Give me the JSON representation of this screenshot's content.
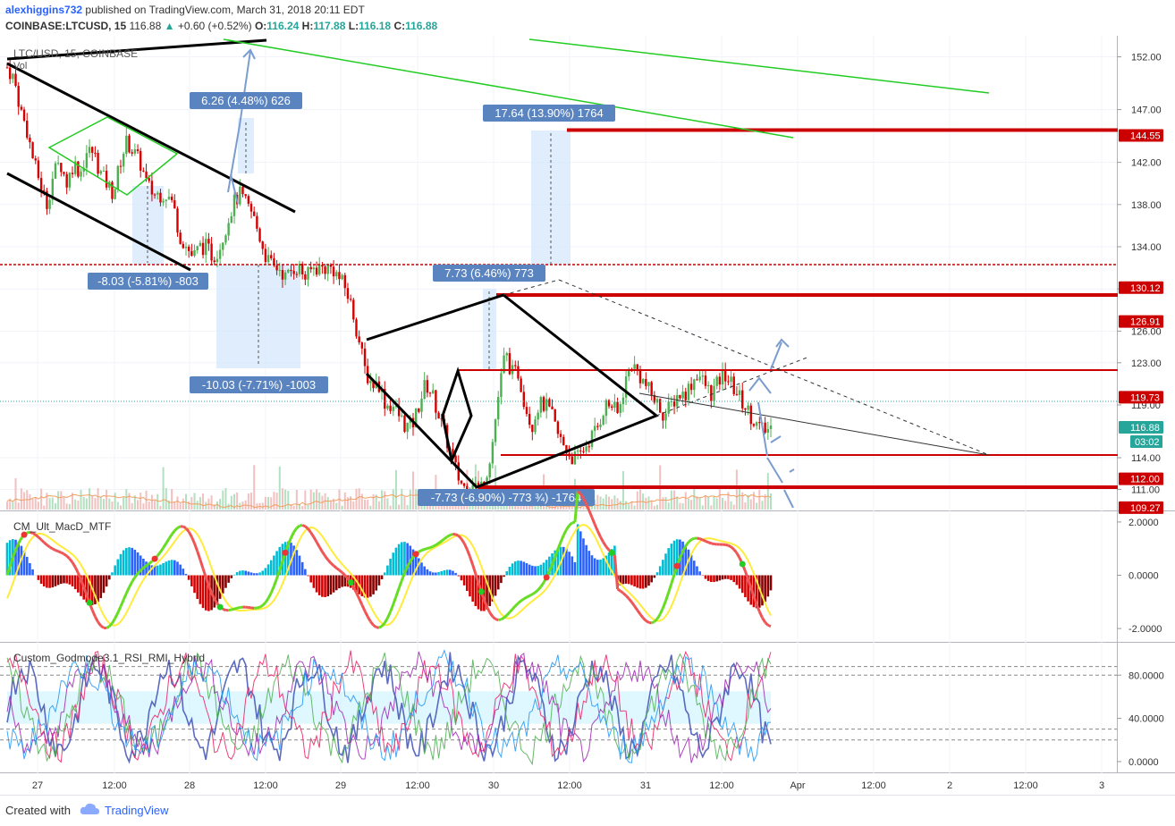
{
  "header": {
    "author": "alexhiggins732",
    "published": "published on TradingView.com, March 31, 2018 20:11 EDT",
    "symbol": "COINBASE:LTCUSD, 15",
    "last": "116.88",
    "change": "+0.60 (+0.52%)",
    "o_label": "O:",
    "o": "116.24",
    "h_label": "H:",
    "h": "117.88",
    "l_label": "L:",
    "l": "116.18",
    "c_label": "C:",
    "c": "116.88"
  },
  "pane_titles": {
    "main": "LTC/USD, 15, COINBASE",
    "vol": "Vol",
    "macd": "CM_Ult_MacD_MTF",
    "rsi": "Custom_Godmode3.1_RSI_RMI_Hybrid"
  },
  "footer": {
    "created_with": "Created with",
    "brand": "TradingView"
  },
  "colors": {
    "up": "#26a69a",
    "down": "#ef5350",
    "candle_up": "#4caf50",
    "candle_down": "#d50000",
    "level_red": "#cc0000",
    "trend_green": "#22cc22",
    "measure_fill": "#d7e8fb",
    "measure_label": "#5a84c0",
    "arrow": "#7a9ccf",
    "brand": "#2962ff"
  },
  "chart_data": [
    {
      "type": "candlestick",
      "title": "LTC/USD, 15, COINBASE",
      "y_ticks": [
        "152.00",
        "147.00",
        "142.00",
        "138.00",
        "134.00",
        "130.00",
        "126.00",
        "123.00",
        "119.00",
        "114.00",
        "111.00"
      ],
      "x_ticks": [
        "27",
        "12:00",
        "28",
        "12:00",
        "29",
        "12:00",
        "30",
        "12:00",
        "31",
        "12:00",
        "Apr",
        "12:00",
        "2",
        "12:00",
        "3"
      ],
      "ylim": [
        109,
        154
      ],
      "price_labels": [
        {
          "value": 144.55,
          "text": "144.55",
          "kind": "level"
        },
        {
          "value": 130.12,
          "text": "130.12",
          "kind": "level"
        },
        {
          "value": 126.91,
          "text": "126.91",
          "kind": "level"
        },
        {
          "value": 119.73,
          "text": "119.73",
          "kind": "level"
        },
        {
          "value": 116.88,
          "text": "116.88",
          "kind": "last"
        },
        {
          "value": 112.0,
          "text": "112.00",
          "kind": "level"
        },
        {
          "value": 109.27,
          "text": "109.27",
          "kind": "level"
        }
      ],
      "countdown": "03:02",
      "measurements": [
        "6.26 (4.48%) 626",
        "17.64 (13.90%) 1764",
        "-8.03 (-5.81%) -803",
        "7.73 (6.46%) 773",
        "-10.03 (-7.71%) -1003",
        "-7.73 (-6.90%) -773 ¾) -1764"
      ],
      "close_path": [
        [
          0,
          151
        ],
        [
          1,
          150
        ],
        [
          2,
          147
        ],
        [
          3,
          145
        ],
        [
          4,
          142
        ],
        [
          5,
          140
        ],
        [
          6,
          138
        ],
        [
          7,
          141
        ],
        [
          8,
          142
        ],
        [
          9,
          140
        ],
        [
          10,
          142
        ],
        [
          11,
          141
        ],
        [
          12,
          143
        ],
        [
          13,
          143
        ],
        [
          14,
          141
        ],
        [
          15,
          140
        ],
        [
          16,
          139
        ],
        [
          17,
          142
        ],
        [
          18,
          144
        ],
        [
          19,
          143
        ],
        [
          20,
          142
        ],
        [
          21,
          140
        ],
        [
          22,
          139
        ],
        [
          23,
          139
        ],
        [
          24,
          139
        ],
        [
          25,
          138
        ],
        [
          26,
          135
        ],
        [
          27,
          134
        ],
        [
          28,
          133
        ],
        [
          29,
          134
        ],
        [
          30,
          134
        ],
        [
          31,
          133
        ],
        [
          32,
          134
        ],
        [
          33,
          136
        ],
        [
          34,
          138
        ],
        [
          35,
          139
        ],
        [
          36,
          138
        ],
        [
          37,
          137
        ],
        [
          38,
          135
        ],
        [
          39,
          133
        ],
        [
          40,
          132
        ],
        [
          41,
          132
        ],
        [
          42,
          131
        ],
        [
          43,
          132
        ],
        [
          44,
          132
        ],
        [
          45,
          131
        ],
        [
          46,
          132
        ],
        [
          47,
          132
        ],
        [
          48,
          132
        ],
        [
          49,
          132
        ],
        [
          50,
          131
        ],
        [
          51,
          130
        ],
        [
          52,
          128
        ],
        [
          53,
          125
        ],
        [
          54,
          122
        ],
        [
          55,
          121
        ],
        [
          56,
          121
        ],
        [
          57,
          119
        ],
        [
          58,
          119
        ],
        [
          59,
          118
        ],
        [
          60,
          117
        ],
        [
          61,
          117
        ],
        [
          62,
          119
        ],
        [
          63,
          121
        ],
        [
          64,
          120
        ],
        [
          65,
          118
        ],
        [
          66,
          116
        ],
        [
          67,
          114
        ],
        [
          68,
          112
        ],
        [
          69,
          111
        ],
        [
          70,
          112
        ],
        [
          71,
          111
        ],
        [
          72,
          112
        ],
        [
          73,
          115
        ],
        [
          74,
          120
        ],
        [
          75,
          124
        ],
        [
          76,
          122
        ],
        [
          77,
          122
        ],
        [
          78,
          119
        ],
        [
          79,
          117
        ],
        [
          80,
          119
        ],
        [
          81,
          119
        ],
        [
          82,
          118
        ],
        [
          83,
          116
        ],
        [
          84,
          115
        ],
        [
          85,
          114
        ],
        [
          86,
          114
        ],
        [
          87,
          115
        ],
        [
          88,
          116
        ],
        [
          89,
          117
        ],
        [
          90,
          119
        ],
        [
          91,
          119
        ],
        [
          92,
          118
        ],
        [
          93,
          121
        ],
        [
          94,
          123
        ],
        [
          95,
          122
        ],
        [
          96,
          121
        ],
        [
          97,
          120
        ],
        [
          98,
          119
        ],
        [
          99,
          118
        ],
        [
          100,
          119
        ],
        [
          101,
          120
        ],
        [
          102,
          120
        ],
        [
          103,
          121
        ],
        [
          104,
          122
        ],
        [
          105,
          121
        ],
        [
          106,
          120
        ],
        [
          107,
          121
        ],
        [
          108,
          122
        ],
        [
          109,
          121
        ],
        [
          110,
          120
        ],
        [
          111,
          119
        ],
        [
          112,
          118
        ],
        [
          113,
          117
        ],
        [
          114,
          116.5
        ],
        [
          115,
          116.88
        ]
      ]
    },
    {
      "type": "macd",
      "title": "CM_Ult_MacD_MTF",
      "y_ticks": [
        "2.0000",
        "0.0000",
        "-2.0000"
      ],
      "ylim": [
        -2.5,
        2.4
      ]
    },
    {
      "type": "rsi",
      "title": "Custom_Godmode3.1_RSI_RMI_Hybrid",
      "y_ticks": [
        "80.0000",
        "40.0000",
        "0.0000"
      ],
      "ylim": [
        -10,
        110
      ]
    }
  ]
}
